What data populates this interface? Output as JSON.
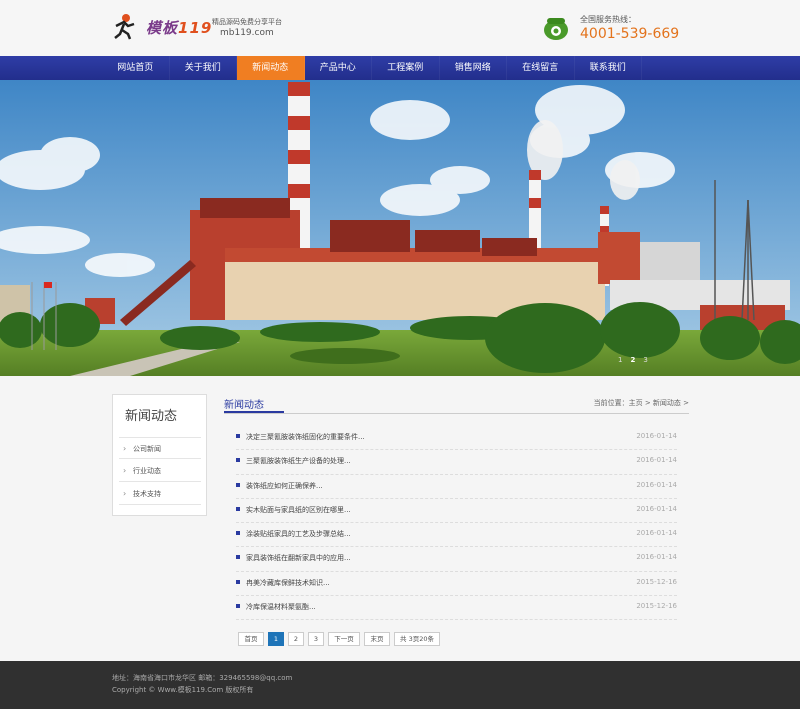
{
  "header": {
    "logo_name": "模板",
    "logo_number": "119",
    "slogan": "精品源码免费分享平台",
    "domain": "mb119.com",
    "hotline_label": "全国服务热线：",
    "hotline_number": "4001-539-669"
  },
  "nav": {
    "items": [
      "网站首页",
      "关于我们",
      "新闻动态",
      "产品中心",
      "工程案例",
      "销售网络",
      "在线留言",
      "联系我们"
    ],
    "active_index": 2
  },
  "banner": {
    "dots": [
      "1",
      "2",
      "3"
    ],
    "active_dot": 1
  },
  "sidebar": {
    "title": "新闻动态",
    "items": [
      "公司新闻",
      "行业动态",
      "技术支持"
    ]
  },
  "main": {
    "title": "新闻动态",
    "breadcrumb": "当前位置：主页 > 新闻动态 >",
    "news": [
      {
        "title": "决定三聚氰胺装饰纸固化的重要条件...",
        "date": "2016-01-14"
      },
      {
        "title": "三聚氰胺装饰纸生产设备的处理...",
        "date": "2016-01-14"
      },
      {
        "title": "装饰纸应如何正确保养...",
        "date": "2016-01-14"
      },
      {
        "title": "实木贴面与家具纸的区别在哪里...",
        "date": "2016-01-14"
      },
      {
        "title": "涂装贴纸家具的工艺及步骤总结...",
        "date": "2016-01-14"
      },
      {
        "title": "家具装饰纸在翻新家具中的应用...",
        "date": "2016-01-14"
      },
      {
        "title": "冉美冷藏库保鲜技术知识...",
        "date": "2015-12-16"
      },
      {
        "title": "冷库保温材料聚氨酯...",
        "date": "2015-12-16"
      }
    ],
    "pager": {
      "first": "首页",
      "pages": [
        "1",
        "2",
        "3"
      ],
      "active_page": "1",
      "next": "下一页",
      "last": "末页",
      "summary": "共 3页20条"
    }
  },
  "footer": {
    "address": "地址：海南省海口市龙华区 邮箱：329465598@qq.com",
    "copyright": "Copyright © Www.模板119.Com 版权所有"
  },
  "colors": {
    "nav_bg": "#2a37a0",
    "nav_active": "#f07e22",
    "hotline": "#e3731c",
    "accent": "#2a3aa0",
    "pager_active": "#1e74b8",
    "footer_bg": "#303030"
  },
  "icons": [
    "logo-runner-icon",
    "phone-icon",
    "chevron-right-icon"
  ]
}
